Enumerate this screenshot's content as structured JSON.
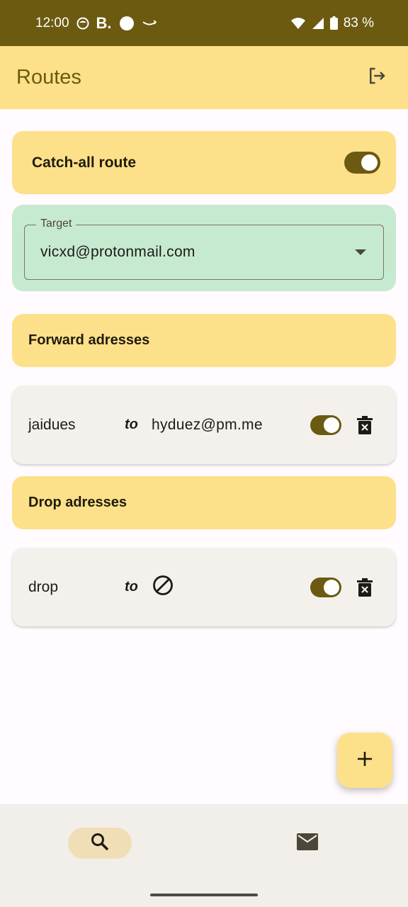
{
  "status_bar": {
    "time": "12:00",
    "b_glyph": "B.",
    "battery": "83 %"
  },
  "app_bar": {
    "title": "Routes",
    "logout_icon": "logout-icon"
  },
  "catch_all": {
    "label": "Catch-all route",
    "enabled": true
  },
  "target": {
    "label": "Target",
    "value": "vicxd@protonmail.com"
  },
  "sections": {
    "forward_title": "Forward adresses",
    "drop_title": "Drop adresses"
  },
  "forward_routes": [
    {
      "from": "jaidues",
      "to_label": "to",
      "target": "hyduez@pm.me",
      "enabled": true
    }
  ],
  "drop_routes": [
    {
      "from": "drop",
      "to_label": "to",
      "target_icon": "block-icon",
      "enabled": true
    }
  ],
  "fab": {
    "icon": "add-icon"
  },
  "bottom_nav": {
    "items": [
      {
        "icon": "search-icon",
        "active": true
      },
      {
        "icon": "mail-icon",
        "active": false
      }
    ]
  },
  "colors": {
    "primary": "#6b5a10",
    "primary_container": "#fde08a",
    "tertiary_container": "#c6ead0",
    "surface": "#fffbfe"
  }
}
